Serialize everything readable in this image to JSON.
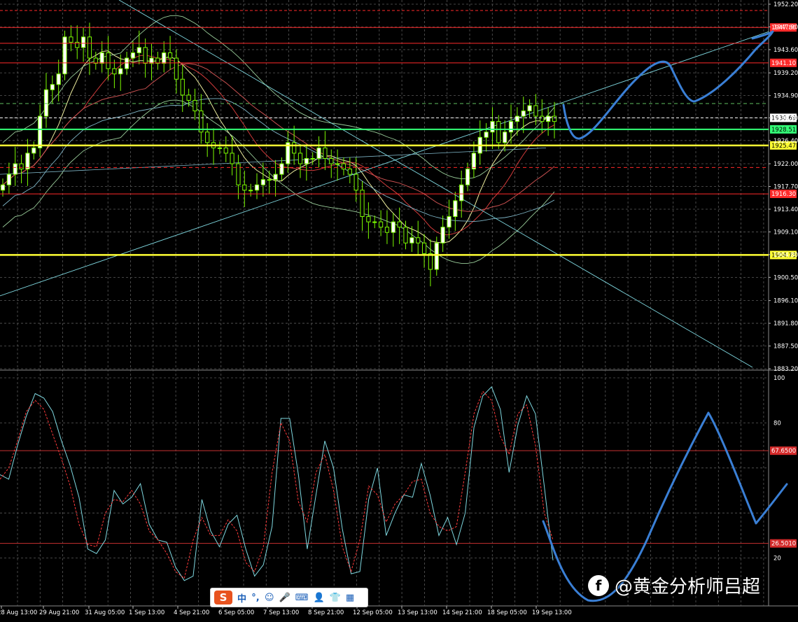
{
  "chart_data": [
    {
      "type": "candlestick",
      "title": "",
      "y_ticks": [
        "1883.20",
        "1887.50",
        "1891.80",
        "1896.10",
        "1900.50",
        "1904.80",
        "1909.10",
        "1913.40",
        "1917.70",
        "1922.00",
        "1926.40",
        "1930.70",
        "1934.90",
        "1939.20",
        "1943.60",
        "1947.90",
        "1952.20"
      ],
      "ylim": [
        1883.2,
        1952.2
      ],
      "x_ticks": [
        "28 Aug 13:00",
        "29 Aug 21:00",
        "31 Aug 05:00",
        "1 Sep 13:00",
        "4 Sep 21:00",
        "6 Sep 05:00",
        "7 Sep 13:00",
        "8 Sep 21:00",
        "12 Sep 05:00",
        "13 Sep 13:00",
        "14 Sep 21:00",
        "18 Sep 05:00",
        "19 Sep 13:00"
      ],
      "close_approx": [
        1918,
        1920,
        1922,
        1921,
        1924,
        1925,
        1931,
        1936,
        1937,
        1939,
        1946,
        1945,
        1944,
        1946,
        1942,
        1941,
        1943,
        1940,
        1939,
        1940,
        1942,
        1943,
        1944,
        1941,
        1942,
        1941,
        1943,
        1942,
        1938,
        1935,
        1934,
        1932,
        1928,
        1926,
        1925,
        1925,
        1924,
        1922,
        1918,
        1917,
        1917,
        1918,
        1919,
        1919,
        1920,
        1922,
        1926,
        1924,
        1922,
        1923,
        1923,
        1925,
        1923,
        1922,
        1922,
        1921,
        1920,
        1917,
        1912,
        1911,
        1911,
        1910,
        1909,
        1911,
        1910,
        1907,
        1908,
        1907,
        1905,
        1902,
        1907,
        1910,
        1912,
        1915,
        1918,
        1921,
        1924,
        1927,
        1928,
        1930,
        1926,
        1928,
        1930,
        1931,
        1932,
        1933,
        1931,
        1930,
        1931,
        1930
      ],
      "horizontal_levels": [
        {
          "value": "1947.80",
          "label": "1947.80",
          "color": "#ff2a2a"
        },
        {
          "value": "1941.10",
          "label": "1941.10",
          "color": "#ff2a2a"
        },
        {
          "value": "1930.69",
          "label": "1930.69",
          "color": "#ffffff"
        },
        {
          "value": "1928.51",
          "label": "1928.51",
          "color": "#33ff77"
        },
        {
          "value": "1925.47",
          "label": "1925.47",
          "color": "#ffff33"
        },
        {
          "value": "1916.30",
          "label": "1916.30",
          "color": "#ff2a2a"
        },
        {
          "value": "1904.73",
          "label": "1904.73",
          "color": "#ffff33"
        }
      ],
      "grid": true,
      "candle_color": "#7CFC00"
    },
    {
      "type": "line",
      "title": "",
      "y_ticks": [
        "100",
        "80",
        "20"
      ],
      "ylim": [
        0,
        100
      ],
      "levels": [
        {
          "value": "67.6500",
          "label": "67.6500"
        },
        {
          "value": "26.5010",
          "label": "26.5010"
        }
      ],
      "series": [
        {
          "color": "#7fd8e0",
          "values": [
            57,
            55,
            70,
            83,
            93,
            91,
            85,
            72,
            61,
            47,
            24,
            22,
            28,
            50,
            44,
            47,
            53,
            35,
            28,
            27,
            16,
            10,
            12,
            46,
            32,
            25,
            35,
            39,
            24,
            12,
            17,
            34,
            82,
            82,
            57,
            24,
            48,
            72,
            60,
            33,
            13,
            14,
            46,
            60,
            30,
            40,
            48,
            47,
            62,
            48,
            30,
            38,
            26,
            40,
            78,
            92,
            96,
            86,
            58,
            79,
            92,
            84,
            52,
            19
          ]
        },
        {
          "color": "#ff3b3b",
          "values": [
            55,
            60,
            72,
            85,
            90,
            86,
            75,
            64,
            52,
            35,
            26,
            25,
            40,
            46,
            45,
            50,
            44,
            32,
            28,
            22,
            14,
            11,
            28,
            38,
            30,
            30,
            37,
            32,
            18,
            14,
            25,
            58,
            80,
            72,
            45,
            36,
            58,
            66,
            50,
            25,
            14,
            28,
            52,
            48,
            36,
            44,
            48,
            54,
            55,
            40,
            34,
            32,
            34,
            58,
            84,
            94,
            90,
            74,
            66,
            84,
            88,
            70,
            40,
            28
          ]
        }
      ]
    }
  ],
  "ime": {
    "logo": "S",
    "items": [
      "中",
      "°,",
      "☺",
      "🎤",
      "⌨",
      "👤",
      "👕",
      "▦"
    ]
  },
  "watermark": {
    "logo": "f",
    "text": "@黄金分析师吕超"
  }
}
